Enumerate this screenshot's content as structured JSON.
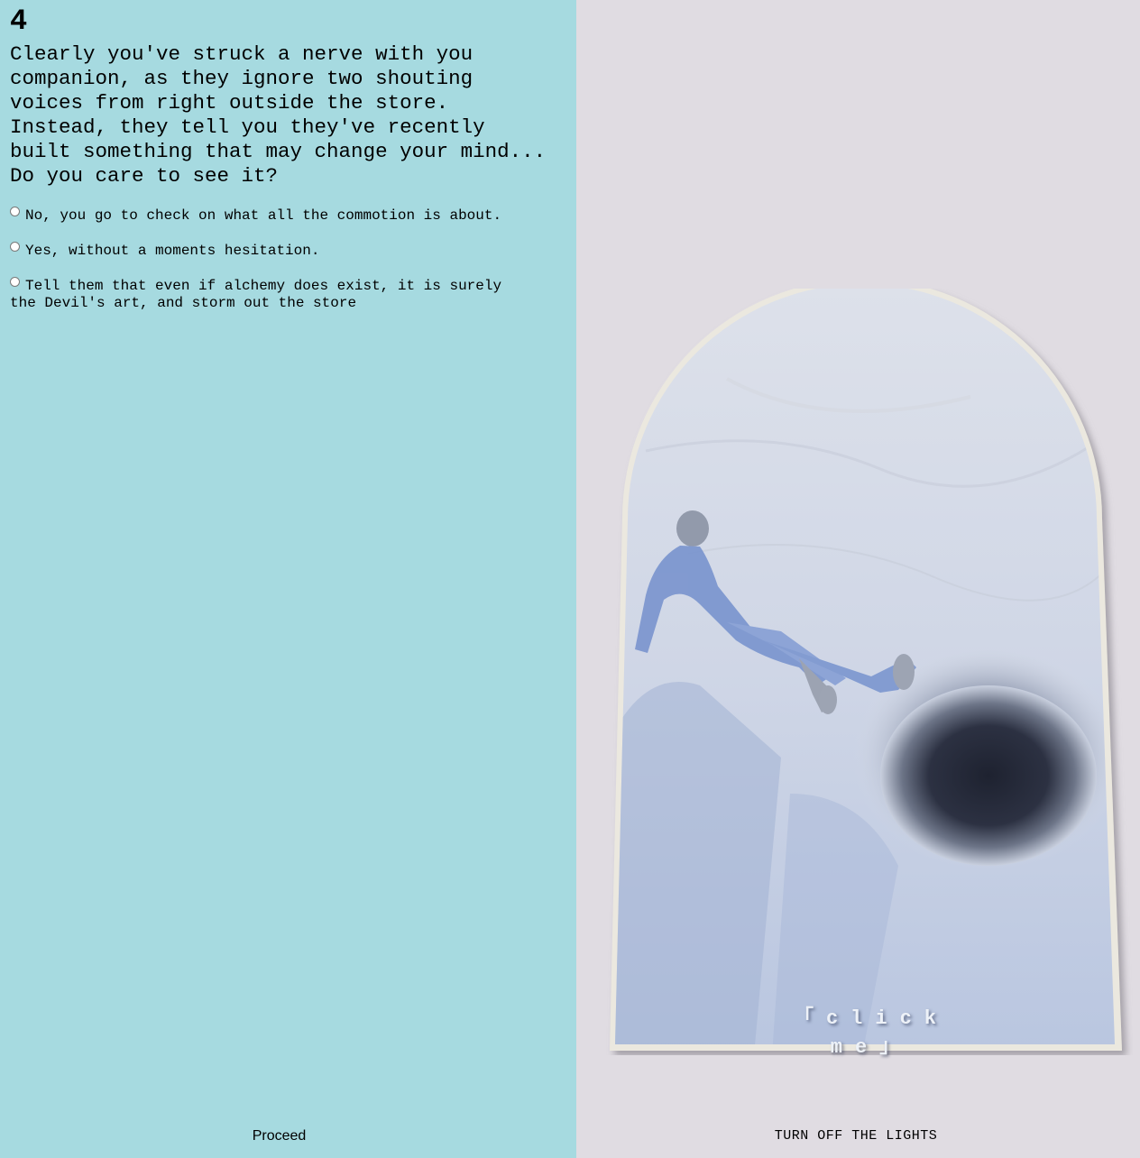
{
  "story": {
    "step": "4",
    "text": "Clearly you've struck a nerve with you companion, as they ignore two shouting voices from right outside the store. Instead, they tell you they've recently built something that may change your mind... Do you care to see it?",
    "choices": [
      {
        "label": "No, you go to check on what all the commotion is about."
      },
      {
        "label": "Yes, without a moments hesitation."
      },
      {
        "label": "Tell them that even if alchemy does exist, it is surely the Devil's art, and storm out the store"
      }
    ],
    "proceed_label": "Proceed"
  },
  "artwork": {
    "overlay_text": "「click me」",
    "lights_label": "TURN OFF THE LIGHTS"
  },
  "colors": {
    "left_background": "#a6dae0",
    "right_background": "#e0dce2",
    "frame": "#ebe8df"
  }
}
